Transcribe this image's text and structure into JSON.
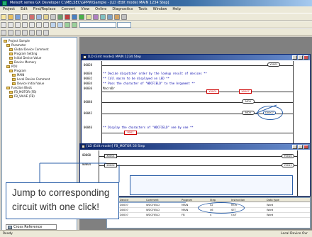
{
  "window": {
    "title": "Melsoft series GX Developer  C:\\MELSEC\\GPPW\\Sample - [LD (Edit mode) MAIN 1234 Step]"
  },
  "menu": [
    "Project",
    "Edit",
    "Find/Replace",
    "Convert",
    "View",
    "Online",
    "Diagnostics",
    "Tools",
    "Window",
    "Help"
  ],
  "tree": [
    "Project Sample",
    "Parameter",
    "Global Device Comment",
    "Program Setting",
    "Initial Device Value",
    "Device Memory",
    "POU",
    "Program",
    "MAIN",
    "Local Device Comment",
    "Device Initial Value",
    "Function Block",
    "FB_MOTOR (FB)",
    "FB_VALVE (FB)"
  ],
  "main_window": {
    "title": "[LD (Edit mode)] MAIN   1234 Step"
  },
  "ladder": [
    {
      "step": "00028",
      "text": ""
    },
    {
      "step": "00030",
      "text": "** Decide dispatcher order by the lookup result of devices **"
    },
    {
      "step": "00032",
      "text": "** Call macro to be displayed on LED **"
    },
    {
      "step": "00034",
      "text": "** Pass the character of \"WDCFIELD\" to the Argument **"
    },
    {
      "step": "00036",
      "text": "MacroDr"
    },
    {
      "step": "00040",
      "text": ""
    },
    {
      "step": "00042",
      "text": ""
    },
    {
      "step": "00046",
      "text": "** Display the characters of \"WDCFIELD\" one by one **"
    }
  ],
  "devices": {
    "contact1": "X0001",
    "contact2": "X0007",
    "coil1": "Y0001",
    "coil2": "MOV",
    "coil3": "D0007",
    "fb_label": "P001"
  },
  "fb_window": {
    "title": "[LD (Edit mode)] FB_MOTOR  56 Step",
    "rows": [
      {
        "step": "00000",
        "a": "X0001",
        "b": "Y0010"
      },
      {
        "step": "00004",
        "a": "X0002",
        "b": "Y0011"
      }
    ]
  },
  "callout": {
    "line1": "Jump to corresponding",
    "line2": "circuit with one click!"
  },
  "reference_tab": "Cross Reference",
  "grid": {
    "headers": [
      "No.",
      "Device",
      "Comment",
      "Program",
      "Step",
      "Instruction",
      "Data type"
    ],
    "rows": [
      [
        "1",
        "D0007",
        "WDCFIELD",
        "MAIN",
        "42",
        "MOV",
        "Word"
      ],
      [
        "2",
        "D0007",
        "WDCFIELD",
        "MAIN",
        "46",
        "SET",
        "Word"
      ],
      [
        "3",
        "D0007",
        "WDCFIELD",
        "FB",
        "4",
        "OUT",
        "Word"
      ]
    ]
  },
  "status": {
    "left": "Ready",
    "right": "Local Device  Ovr"
  },
  "colors": {
    "title_blue": "#0a246a",
    "highlight": "#2b5fa8",
    "red_contact": "#cc0000"
  }
}
